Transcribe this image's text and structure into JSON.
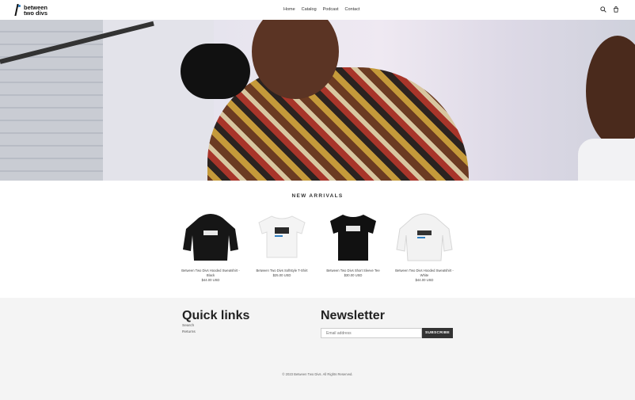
{
  "brand": {
    "name_line1": "between",
    "name_line2": "two divs",
    "accent": "#2f7fc1"
  },
  "nav": {
    "items": [
      "Home",
      "Catalog",
      "Podcast",
      "Contact"
    ]
  },
  "header_icons": {
    "search": "search-icon",
    "cart": "cart-icon"
  },
  "new_arrivals": {
    "title": "NEW ARRIVALS",
    "products": [
      {
        "name": "Between Two Divs Hooded Sweatshirt - Black",
        "price": "$44.00 USD",
        "color": "#161616"
      },
      {
        "name": "Between Two Divs Softstyle T-Shirt",
        "price": "$25.00 USD",
        "color": "#f4f4f4"
      },
      {
        "name": "Between Two Divs Short Sleeve Tee",
        "price": "$30.00 USD",
        "color": "#111111"
      },
      {
        "name": "Between Two Divs Hooded Sweatshirt - White",
        "price": "$44.00 USD",
        "color": "#f2f2f2"
      }
    ]
  },
  "footer": {
    "quick_links_title": "Quick links",
    "quick_links": [
      "Search",
      "Returns"
    ],
    "newsletter_title": "Newsletter",
    "newsletter_placeholder": "Email address",
    "subscribe_label": "SUBSCRIBE",
    "copyright": "© 2023 Between Two Divs. All Rights Reserved."
  }
}
